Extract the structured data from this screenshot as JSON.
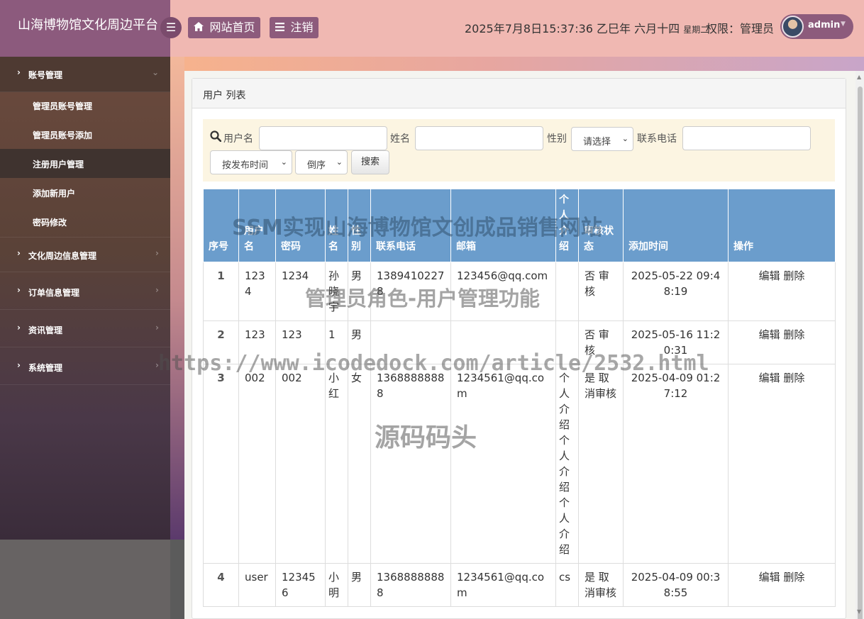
{
  "header": {
    "app_title": "山海博物馆文化周边平台",
    "menu_toggle_glyph": "☰",
    "home_label": "网站首页",
    "logout_label": "注销",
    "datetime": "2025年7月8日15:37:36 乙巳年 六月十四",
    "weekday": "星期二",
    "role_text": "权限：管理员",
    "username": "admin"
  },
  "sidebar": {
    "groups": [
      {
        "label": "账号管理",
        "open": true
      },
      {
        "label": "文化周边信息管理"
      },
      {
        "label": "订单信息管理"
      },
      {
        "label": "资讯管理"
      },
      {
        "label": "系统管理"
      }
    ],
    "subitems": [
      {
        "label": "管理员账号管理"
      },
      {
        "label": "管理员账号添加"
      },
      {
        "label": "注册用户管理",
        "active": true
      },
      {
        "label": "添加新用户"
      },
      {
        "label": "密码修改"
      }
    ]
  },
  "panel": {
    "title": "用户 列表"
  },
  "search": {
    "username_label": "用户名",
    "name_label": "姓名",
    "gender_label": "性别",
    "gender_select": "请选择",
    "phone_label": "联系电话",
    "sort_field_select": "按发布时间",
    "sort_order_select": "倒序",
    "search_button": "搜索"
  },
  "table": {
    "headers": [
      "序号",
      "用户名",
      "密码",
      "姓名",
      "性别",
      "联系电话",
      "邮箱",
      "个人介绍",
      "审核状态",
      "添加时间",
      "操作"
    ],
    "rows": [
      {
        "idx": "1",
        "username": "1234",
        "password": "1234",
        "name": "孙晓宇",
        "gender": "男",
        "phone": "13894102278",
        "email": "123456@qq.com",
        "intro": "",
        "status": "否 审核",
        "time": "2025-05-22 09:48:19",
        "edit": "编辑",
        "delete": "删除"
      },
      {
        "idx": "2",
        "username": "123",
        "password": "123",
        "name": "1",
        "gender": "男",
        "phone": "",
        "email": "",
        "intro": "",
        "status": "否 审核",
        "time": "2025-05-16 11:20:31",
        "edit": "编辑",
        "delete": "删除"
      },
      {
        "idx": "3",
        "username": "002",
        "password": "002",
        "name": "小红",
        "gender": "女",
        "phone": "13688888888",
        "email": "1234561@qq.com",
        "intro": "个人介绍个人介绍个人介绍",
        "status": "是 取消审核",
        "time": "2025-04-09 01:27:12",
        "edit": "编辑",
        "delete": "删除"
      },
      {
        "idx": "4",
        "username": "user",
        "password": "123456",
        "name": "小明",
        "gender": "男",
        "phone": "13688888888",
        "email": "1234561@qq.com",
        "intro": "cs",
        "status": "是 取消审核",
        "time": "2025-04-09 00:38:55",
        "edit": "编辑",
        "delete": "删除"
      }
    ]
  },
  "watermarks": {
    "line1": "SSM实现山海博物馆文创成品销售网站",
    "line2": "管理员角色-用户管理功能",
    "line3": "https://www.icodedock.com/article/2532.html",
    "line4": "源码码头"
  },
  "colors": {
    "header_bg": "#f0b8b2",
    "brand_bg": "#8c5a7d",
    "accent_button": "#8d5b7c",
    "table_header": "#6b9dcc",
    "search_bg": "#fcf5e2"
  }
}
